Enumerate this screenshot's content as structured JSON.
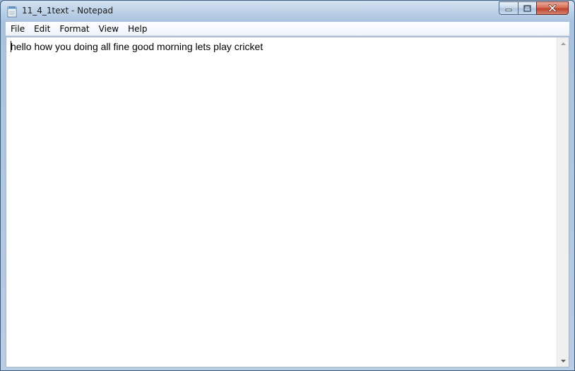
{
  "window": {
    "title": "11_4_1text - Notepad",
    "app_icon": "notepad-icon",
    "caption_buttons": [
      "minimize-icon",
      "maximize-icon",
      "close-icon"
    ]
  },
  "menu": {
    "items": [
      {
        "label": "File"
      },
      {
        "label": "Edit"
      },
      {
        "label": "Format"
      },
      {
        "label": "View"
      },
      {
        "label": "Help"
      }
    ]
  },
  "editor": {
    "content": "hello how you doing all fine good morning lets play cricket"
  },
  "colors": {
    "title_glass": "#bfd3e8",
    "editor_background": "#ffffff",
    "close_button": "#c0432b"
  }
}
